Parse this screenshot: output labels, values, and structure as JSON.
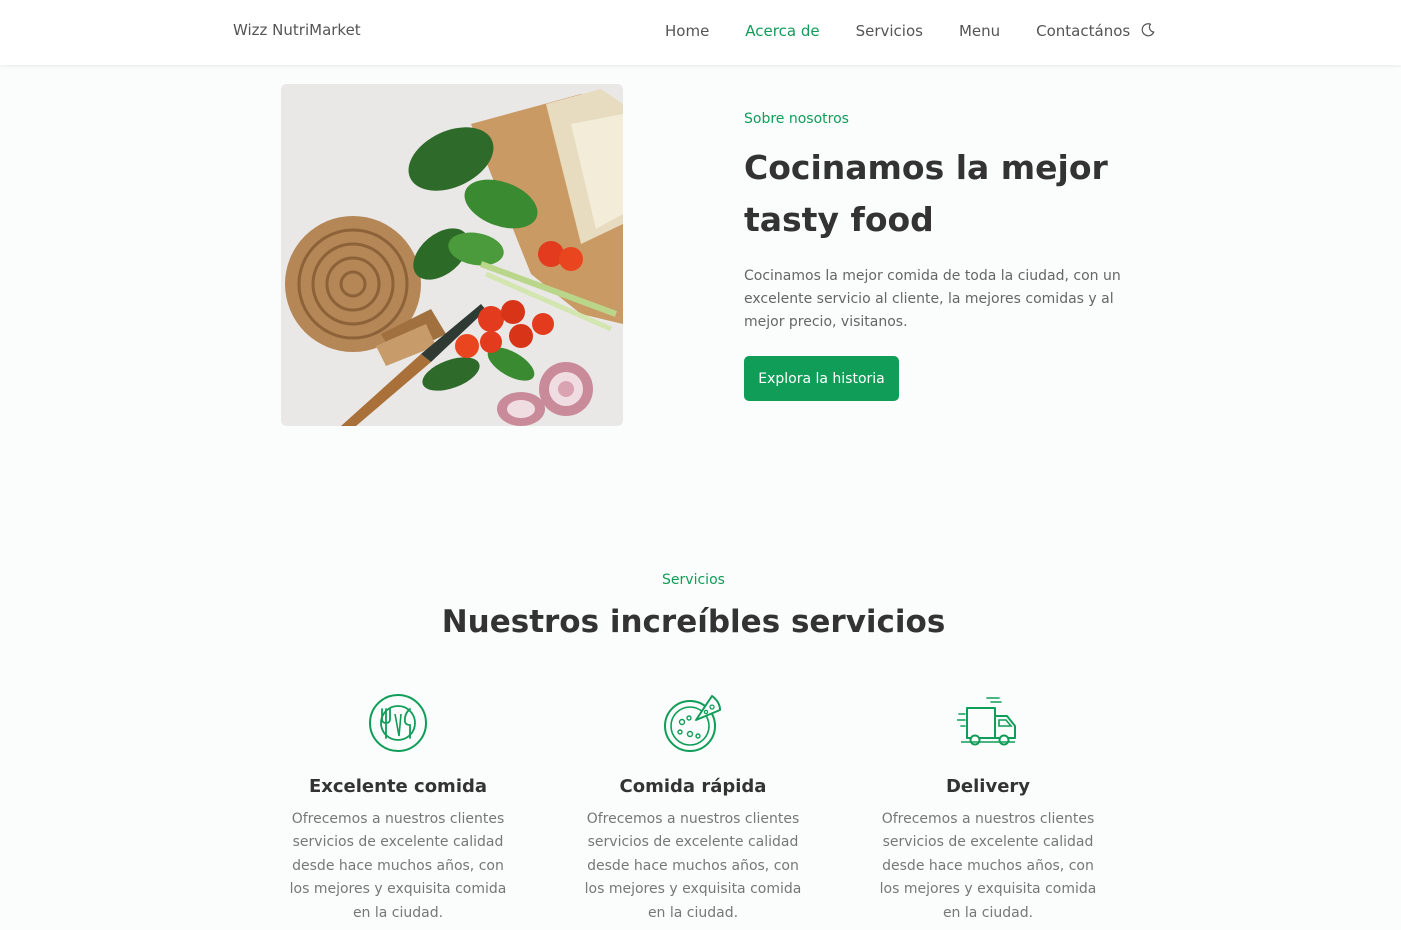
{
  "header": {
    "logo": "Wizz NutriMarket",
    "nav": [
      {
        "label": "Home",
        "active": false
      },
      {
        "label": "Acerca de",
        "active": true
      },
      {
        "label": "Servicios",
        "active": false
      },
      {
        "label": "Menu",
        "active": false
      },
      {
        "label": "Contactános",
        "active": false
      }
    ],
    "theme_icon": "moon-icon"
  },
  "about": {
    "subtitle": "Sobre nosotros",
    "title": "Cocinamos la mejor tasty food",
    "description": "Cocinamos la mejor comida de toda la ciudad, con un excelente servicio al cliente, la mejores comidas y al mejor precio, visitanos.",
    "button": "Explora la historia",
    "image": "food-ingredients-photo"
  },
  "services": {
    "subtitle": "Servicios",
    "title": "Nuestros increíbles servicios",
    "items": [
      {
        "icon": "cutlery-plate-icon",
        "title": "Excelente comida",
        "description": "Ofrecemos a nuestros clientes servicios de excelente calidad desde hace muchos años, con los mejores y exquisita comida en la ciudad."
      },
      {
        "icon": "pizza-icon",
        "title": "Comida rápida",
        "description": "Ofrecemos a nuestros clientes servicios de excelente calidad desde hace muchos años, con los mejores y exquisita comida en la ciudad."
      },
      {
        "icon": "delivery-truck-icon",
        "title": "Delivery",
        "description": "Ofrecemos a nuestros clientes servicios de excelente calidad desde hace muchos años, con los mejores y exquisita comida en la ciudad."
      }
    ]
  },
  "colors": {
    "accent": "#0f9d58",
    "heading": "#333333",
    "text": "#666666"
  }
}
